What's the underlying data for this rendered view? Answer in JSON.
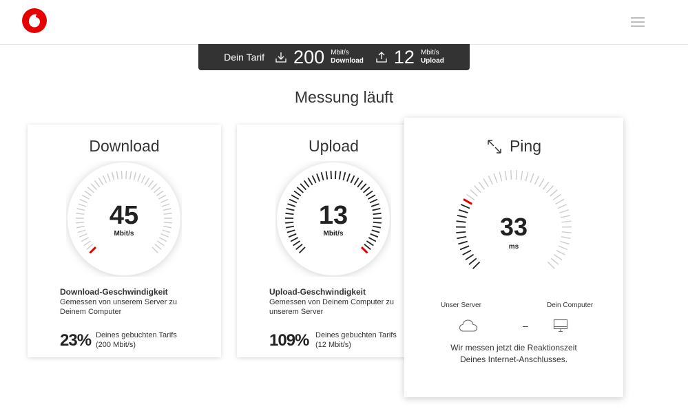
{
  "header": {
    "logo": "vodafone-logo",
    "menu_icon": "hamburger-menu-icon"
  },
  "tarif": {
    "label": "Dein Tarif",
    "download_value": "200",
    "download_unit": "Mbit/s",
    "download_label": "Download",
    "upload_value": "12",
    "upload_unit": "Mbit/s",
    "upload_label": "Upload"
  },
  "title": "Messung läuft",
  "download": {
    "title": "Download",
    "value": "45",
    "unit": "Mbit/s",
    "gauge_fraction": 0.0,
    "desc_title": "Download-Geschwindigkeit",
    "desc_line1": "Gemessen von unserem Server zu",
    "desc_line2": "Deinem Computer",
    "percent": "23%",
    "percent_line1": "Deines gebuchten Tarifs",
    "percent_line2": "(200 Mbit/s)"
  },
  "upload": {
    "title": "Upload",
    "value": "13",
    "unit": "Mbit/s",
    "gauge_fraction": 1.0,
    "desc_title": "Upload-Geschwindigkeit",
    "desc_line1": "Gemessen von Deinem Computer zu",
    "desc_line2": "unserem Server",
    "percent": "109%",
    "percent_line1": "Deines gebuchten Tarifs",
    "percent_line2": "(12 Mbit/s)"
  },
  "ping": {
    "title": "Ping",
    "value": "33",
    "unit": "ms",
    "gauge_fraction": 0.27,
    "server_label": "Unser Server",
    "computer_label": "Dein Computer",
    "connector": "–",
    "msg_line1": "Wir messen jetzt die Reaktionszeit",
    "msg_line2": "Deines Internet-Anschlusses."
  },
  "colors": {
    "brand": "#e60000",
    "dark_bar": "#333333",
    "tick_active": "#222222",
    "tick_inactive": "#cccccc"
  }
}
